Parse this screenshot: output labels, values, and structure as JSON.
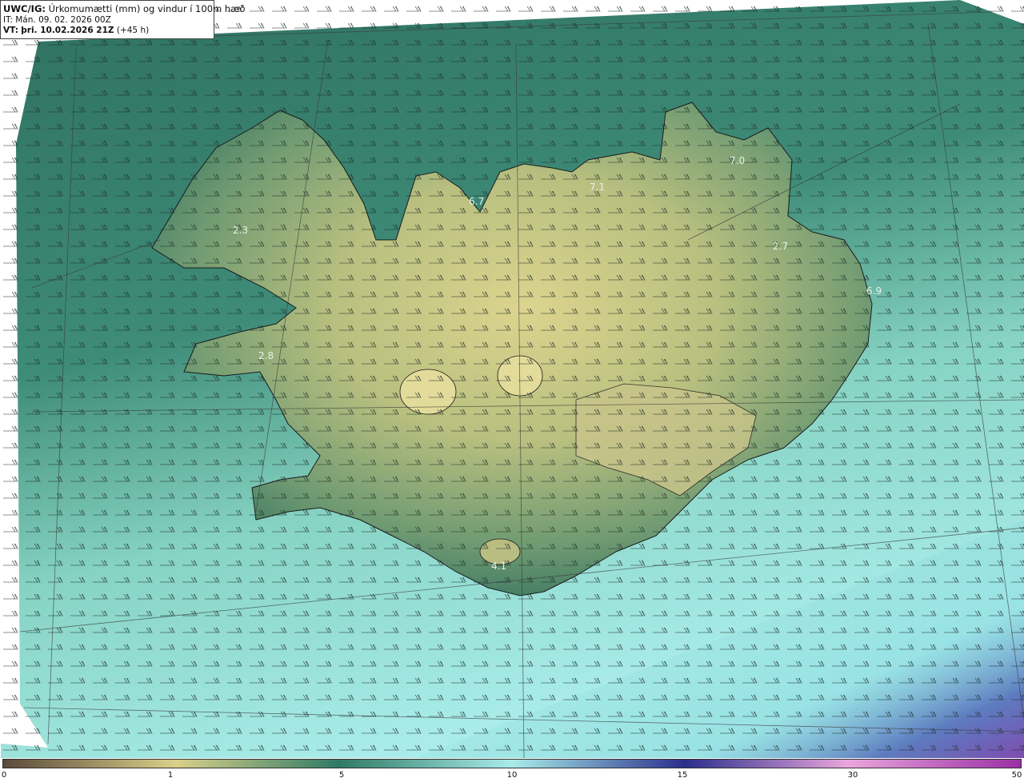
{
  "title": {
    "model": "UWC/IG:",
    "field": "Úrkomumætti (mm) og vindur í 100m hæð",
    "init_label": "IT:",
    "init_time": "Mán. 09. 02. 2026 00Z",
    "valid_label": "VT:",
    "valid_time": "þri. 10.02.2026 21Z",
    "lead": "(+45 h)"
  },
  "point_values": [
    {
      "label": "2.3"
    },
    {
      "label": "6.7"
    },
    {
      "label": "7.1"
    },
    {
      "label": "7.0"
    },
    {
      "label": "2.7"
    },
    {
      "label": "6.9"
    },
    {
      "label": "2.8"
    },
    {
      "label": "4.1"
    }
  ],
  "colorbar": {
    "ticks": [
      {
        "value": "0"
      },
      {
        "value": "1"
      },
      {
        "value": "5"
      },
      {
        "value": "10"
      },
      {
        "value": "15"
      },
      {
        "value": "30"
      },
      {
        "value": "50"
      }
    ],
    "colors": {
      "dry": "#5a4a3a",
      "low": "#d9d08a",
      "mid": "#2f7a65",
      "high": "#a8ecea",
      "heavy": "#2a2f8c",
      "extreme": "#9a2fa5"
    }
  }
}
